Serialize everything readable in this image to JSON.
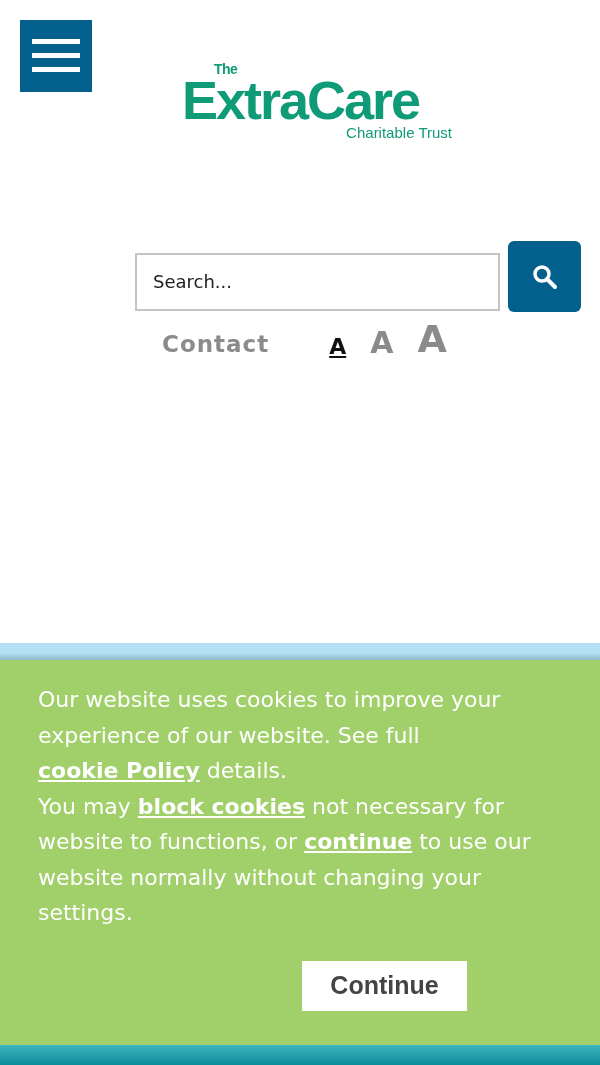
{
  "logo": {
    "small": "The",
    "main": "ExtraCare",
    "sub": "Charitable Trust"
  },
  "search": {
    "placeholder": "Search..."
  },
  "utility": {
    "contact": "Contact",
    "text_sizes": [
      {
        "label": "A",
        "selected": true
      },
      {
        "label": "A",
        "selected": false
      },
      {
        "label": "A",
        "selected": false
      }
    ]
  },
  "cookie_banner": {
    "paragraphs": [
      [
        {
          "kind": "text",
          "text": "Our website uses cookies to improve your experience of our website. See full "
        },
        {
          "kind": "link",
          "text": "cookie Policy"
        },
        {
          "kind": "text",
          "text": " details."
        }
      ],
      [
        {
          "kind": "text",
          "text": "You may "
        },
        {
          "kind": "link",
          "text": "block cookies"
        },
        {
          "kind": "text",
          "text": " not necessary for website to functions, or "
        },
        {
          "kind": "link",
          "text": "continue"
        },
        {
          "kind": "text",
          "text": " to use our website normally without changing your settings."
        }
      ]
    ],
    "button": "Continue"
  }
}
